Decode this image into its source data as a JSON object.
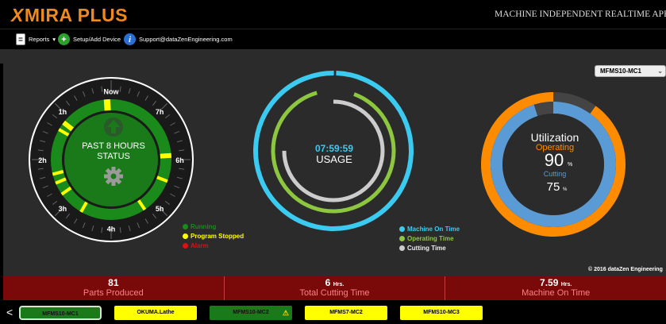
{
  "header": {
    "logo_mark": "X",
    "logo_text": "MIRA PLUS",
    "tagline": "MACHINE INDEPENDENT REALTIME APPLICATIONS"
  },
  "toolbar": {
    "reports_label": "Reports",
    "setup_label": "Setup/Add Device",
    "support_label": "Support@dataZenEngineering.com"
  },
  "machine_select": {
    "value": "MFMS10-MC1"
  },
  "status_dial": {
    "title_line1": "PAST 8 HOURS",
    "title_line2": "STATUS",
    "hours": [
      "Now",
      "1h",
      "2h",
      "3h",
      "4h",
      "5h",
      "6h",
      "7h"
    ]
  },
  "status_legend": [
    {
      "label": "Running",
      "color": "#1a8a1a"
    },
    {
      "label": "Program Stopped",
      "color": "#ffff00"
    },
    {
      "label": "Alarm",
      "color": "#e01010"
    }
  ],
  "usage": {
    "time": "07:59:59",
    "label": "USAGE",
    "machine_on_fraction": 0.995,
    "operating_fraction": 0.9,
    "cutting_fraction": 0.75
  },
  "usage_legend": [
    {
      "label": "Machine On Time",
      "color": "#3ccbf0"
    },
    {
      "label": "Operating Time",
      "color": "#8dc63f"
    },
    {
      "label": "Cutting Time",
      "color": "#cccccc"
    }
  ],
  "utilization": {
    "title": "Utilization",
    "operating_label": "Operating",
    "operating_value": "90",
    "cutting_label": "Cutting",
    "cutting_value": "75",
    "unit": "%",
    "operating_fraction": 0.9,
    "cutting_fraction": 0.75
  },
  "copyright": "© 2016 dataZen Engineering",
  "stats": [
    {
      "value": "81",
      "unit": "",
      "label": "Parts Produced"
    },
    {
      "value": "6",
      "unit": "Hrs.",
      "label": "Total Cutting Time"
    },
    {
      "value": "7.59",
      "unit": "Hrs.",
      "label": "Machine On Time"
    }
  ],
  "machine_tabs": {
    "back": "<",
    "items": [
      {
        "label": "MFMS10-MC1",
        "status": "green"
      },
      {
        "label": "OKUMA.Lathe",
        "status": "yellow"
      },
      {
        "label": "MFMS10-MC2",
        "status": "green"
      },
      {
        "label": "MFMS7-MC2",
        "status": "yellow"
      },
      {
        "label": "MFMS10-MC3",
        "status": "yellow"
      }
    ]
  },
  "colors": {
    "accent_orange": "#f08a1e",
    "running_green": "#1a8a1a",
    "stopped_yellow": "#ffff00",
    "usage_blue": "#3ccbf0",
    "utilization_blue": "#5b9bd5",
    "stats_bg": "#7a0a0a"
  }
}
